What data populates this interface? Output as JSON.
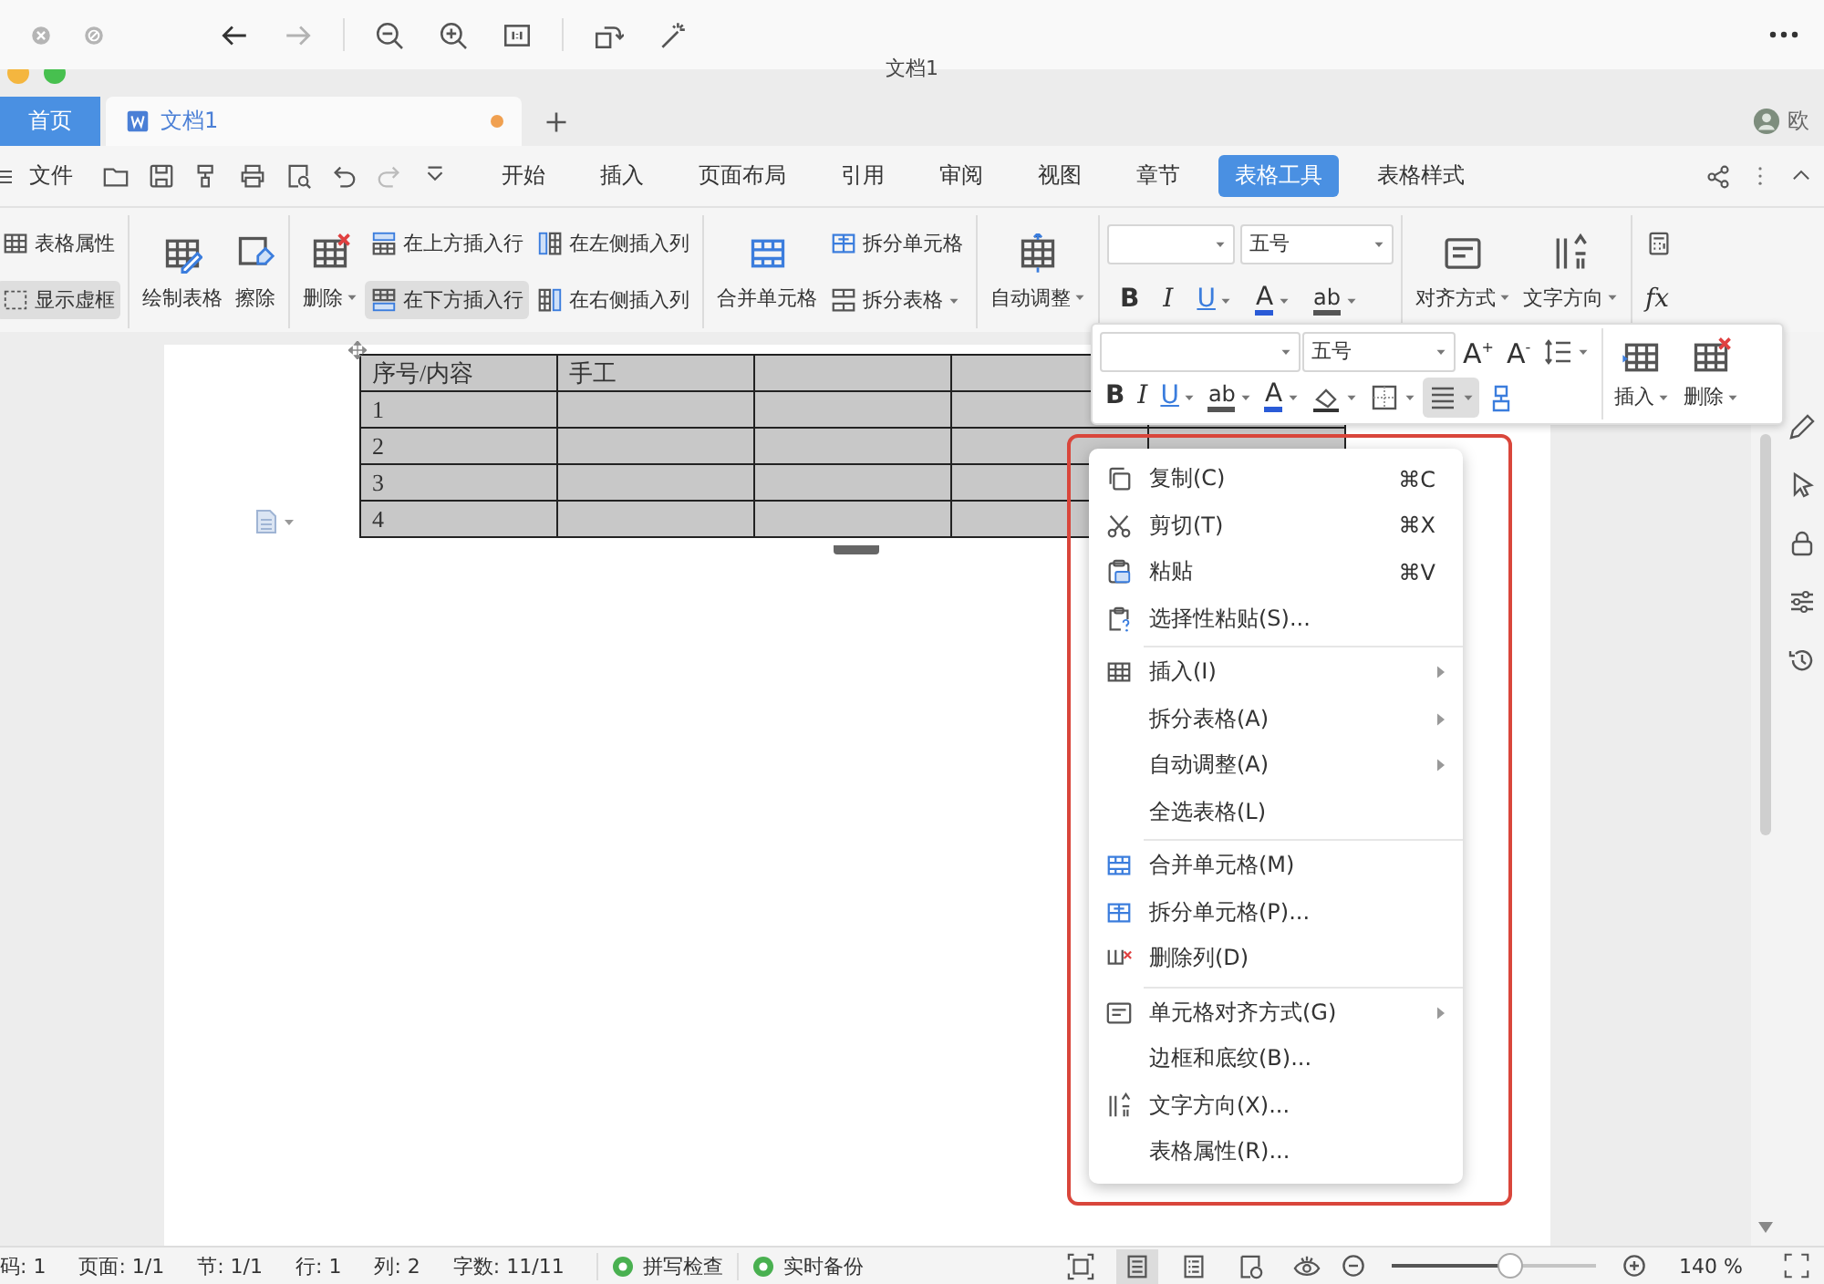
{
  "browser_toolbar": {
    "groups": [
      [
        {
          "kind": "close",
          "disabled": false
        },
        {
          "kind": "stop",
          "disabled": false
        }
      ],
      [
        {
          "kind": "back",
          "disabled": false
        },
        {
          "kind": "forward",
          "disabled": true
        }
      ],
      [
        {
          "kind": "zoom-out",
          "disabled": false
        },
        {
          "kind": "zoom-in",
          "disabled": false
        },
        {
          "kind": "fit",
          "disabled": false
        }
      ],
      [
        {
          "kind": "rotate",
          "disabled": false
        },
        {
          "kind": "wand",
          "disabled": false
        }
      ]
    ]
  },
  "window": {
    "title": "文档1"
  },
  "tabs": [
    {
      "label": "首页",
      "kind": "home",
      "selected": false,
      "modified": false
    },
    {
      "label": "文档1",
      "kind": "document",
      "selected": true,
      "modified": true
    }
  ],
  "user": {
    "name": "欧"
  },
  "menu_bar": {
    "file": "文件",
    "tabs": [
      {
        "label": "开始",
        "selected": false
      },
      {
        "label": "插入",
        "selected": false
      },
      {
        "label": "页面布局",
        "selected": false
      },
      {
        "label": "引用",
        "selected": false
      },
      {
        "label": "审阅",
        "selected": false
      },
      {
        "label": "视图",
        "selected": false
      },
      {
        "label": "章节",
        "selected": false
      },
      {
        "label": "表格工具",
        "selected": true
      },
      {
        "label": "表格样式",
        "selected": false
      }
    ]
  },
  "ribbon": {
    "groups": [
      {
        "kind": "tools",
        "columns": [
          {
            "kind": "stack",
            "items": [
              {
                "label": "表格属性",
                "kind": "table-props",
                "dropdown": false,
                "selected": false
              },
              {
                "label": "显示虚框",
                "kind": "frame",
                "dropdown": false,
                "selected": true
              }
            ]
          }
        ]
      },
      {
        "kind": "tools",
        "columns": [
          {
            "kind": "large",
            "items": [
              {
                "label": "绘制表格",
                "kind": "draw-table",
                "dropdown": false,
                "selected": false
              }
            ]
          },
          {
            "kind": "large",
            "items": [
              {
                "label": "擦除",
                "kind": "eraser",
                "dropdown": false,
                "selected": false
              }
            ]
          }
        ]
      },
      {
        "kind": "tools",
        "columns": [
          {
            "kind": "large",
            "items": [
              {
                "label": "删除",
                "kind": "delete-table",
                "dropdown": true,
                "selected": false
              }
            ]
          },
          {
            "kind": "stack",
            "items": [
              {
                "label": "在上方插入行",
                "kind": "insert-above",
                "dropdown": false,
                "selected": false
              },
              {
                "label": "在下方插入行",
                "kind": "insert-below",
                "dropdown": false,
                "selected": true
              }
            ]
          },
          {
            "kind": "stack",
            "items": [
              {
                "label": "在左侧插入列",
                "kind": "insert-left",
                "dropdown": false,
                "selected": false
              },
              {
                "label": "在右侧插入列",
                "kind": "insert-right",
                "dropdown": false,
                "selected": false
              }
            ]
          }
        ]
      },
      {
        "kind": "tools",
        "columns": [
          {
            "kind": "large",
            "items": [
              {
                "label": "合并单元格",
                "kind": "merge",
                "dropdown": false,
                "selected": false
              }
            ]
          },
          {
            "kind": "stack",
            "items": [
              {
                "label": "拆分单元格",
                "kind": "split-cells",
                "dropdown": false,
                "selected": false
              },
              {
                "label": "拆分表格",
                "kind": "split-table",
                "dropdown": true,
                "selected": false
              }
            ]
          }
        ]
      },
      {
        "kind": "tools",
        "columns": [
          {
            "kind": "large",
            "items": [
              {
                "label": "自动调整",
                "kind": "autofit",
                "dropdown": true,
                "selected": false
              }
            ]
          }
        ]
      },
      {
        "kind": "font",
        "size": "五号",
        "buttons": [
          {
            "glyph": "B",
            "kind": "bold",
            "dropdown": false,
            "selected": false
          },
          {
            "glyph": "I",
            "kind": "italic",
            "dropdown": false,
            "selected": false
          },
          {
            "glyph": "U",
            "kind": "underline",
            "dropdown": true,
            "selected": false
          },
          {
            "glyph": "A",
            "kind": "font-color",
            "dropdown": true,
            "selected": false
          },
          {
            "glyph": "ab",
            "kind": "highlight",
            "dropdown": true,
            "selected": false
          }
        ]
      },
      {
        "kind": "tools",
        "columns": [
          {
            "kind": "large",
            "items": [
              {
                "label": "对齐方式",
                "kind": "align",
                "dropdown": true,
                "selected": false
              }
            ]
          },
          {
            "kind": "large",
            "items": [
              {
                "label": "文字方向",
                "kind": "text-dir",
                "dropdown": true,
                "selected": false
              }
            ]
          }
        ]
      },
      {
        "kind": "tools",
        "columns": [
          {
            "kind": "stack",
            "items": [
              {
                "kind": "calc",
                "dropdown": false,
                "selected": false
              },
              {
                "glyph": "fx",
                "kind": "formula",
                "dropdown": false,
                "selected": false
              }
            ]
          }
        ]
      }
    ]
  },
  "table": {
    "rows": [
      [
        "序号/内容",
        "手工",
        "",
        ""
      ],
      [
        "1",
        "",
        "",
        "",
        ""
      ],
      [
        "2",
        "",
        "",
        "",
        ""
      ],
      [
        "3",
        "",
        "",
        ""
      ],
      [
        "4",
        "",
        "",
        ""
      ]
    ]
  },
  "floating_toolbar": {
    "size": "五号",
    "row1": [
      {
        "glyph": "A$^{+}$",
        "kind": "grow",
        "dropdown": false,
        "selected": false
      },
      {
        "glyph": "A$^{-}$",
        "kind": "shrink",
        "dropdown": false,
        "selected": false
      },
      {
        "kind": "line-spacing",
        "dropdown": true,
        "selected": false
      }
    ],
    "row2": [
      {
        "glyph": "B",
        "kind": "bold",
        "dropdown": false,
        "selected": false
      },
      {
        "glyph": "I",
        "kind": "italic",
        "dropdown": false,
        "selected": false
      },
      {
        "glyph": "U",
        "kind": "underline",
        "dropdown": true,
        "selected": false
      },
      {
        "glyph": "ab",
        "kind": "highlight",
        "dropdown": true,
        "selected": false
      },
      {
        "glyph": "A",
        "kind": "font-color",
        "dropdown": true,
        "selected": false
      },
      {
        "kind": "shading",
        "dropdown": true,
        "selected": false
      },
      {
        "kind": "border",
        "dropdown": true,
        "selected": false
      },
      {
        "kind": "align-lines",
        "dropdown": true,
        "selected": true
      },
      {
        "kind": "painter",
        "dropdown": false,
        "selected": false
      }
    ],
    "large": [
      {
        "label": "插入",
        "kind": "insert-table",
        "dropdown": true,
        "selected": false
      },
      {
        "label": "删除",
        "kind": "delete-table",
        "dropdown": true,
        "selected": false
      }
    ]
  },
  "context_menu": {
    "sections": [
      [
        {
          "label": "复制(C)",
          "kind": "copy",
          "shortcut": "⌘C",
          "submenu": false
        },
        {
          "label": "剪切(T)",
          "kind": "cut",
          "shortcut": "⌘X",
          "submenu": false
        },
        {
          "label": "粘贴",
          "kind": "paste",
          "shortcut": "⌘V",
          "submenu": false
        },
        {
          "label": "选择性粘贴(S)...",
          "kind": "paste-special",
          "submenu": false
        }
      ],
      [
        {
          "label": "插入(I)",
          "kind": "table",
          "submenu": true
        },
        {
          "label": "拆分表格(A)",
          "kind": "plain",
          "submenu": true
        },
        {
          "label": "自动调整(A)",
          "kind": "plain",
          "submenu": true
        },
        {
          "label": "全选表格(L)",
          "kind": "plain",
          "submenu": false
        }
      ],
      [
        {
          "label": "合并单元格(M)",
          "kind": "merge",
          "submenu": false
        },
        {
          "label": "拆分单元格(P)...",
          "kind": "split-cells",
          "submenu": false
        },
        {
          "label": "删除列(D)",
          "kind": "delete-col",
          "submenu": false
        }
      ],
      [
        {
          "label": "单元格对齐方式(G)",
          "kind": "align",
          "submenu": true
        },
        {
          "label": "边框和底纹(B)...",
          "kind": "plain",
          "submenu": false
        },
        {
          "label": "文字方向(X)...",
          "kind": "text-dir",
          "submenu": false
        },
        {
          "label": "表格属性(R)...",
          "kind": "plain",
          "submenu": false
        }
      ]
    ]
  },
  "status_bar": {
    "fields": [
      "码: 1",
      "页面: 1/1",
      "节: 1/1",
      "行: 1",
      "列: 2",
      "字数: 11/11"
    ],
    "toggles": [
      {
        "label": "拼写检查",
        "on": true
      },
      {
        "label": "实时备份",
        "on": true
      }
    ],
    "views": [
      {
        "kind": "focus",
        "selected": false
      },
      {
        "kind": "page",
        "selected": true
      },
      {
        "kind": "outline",
        "selected": false
      },
      {
        "kind": "web",
        "selected": false
      },
      {
        "kind": "eye",
        "selected": false
      }
    ],
    "zoom": {
      "level": 0.58,
      "reading": "140 %"
    }
  }
}
